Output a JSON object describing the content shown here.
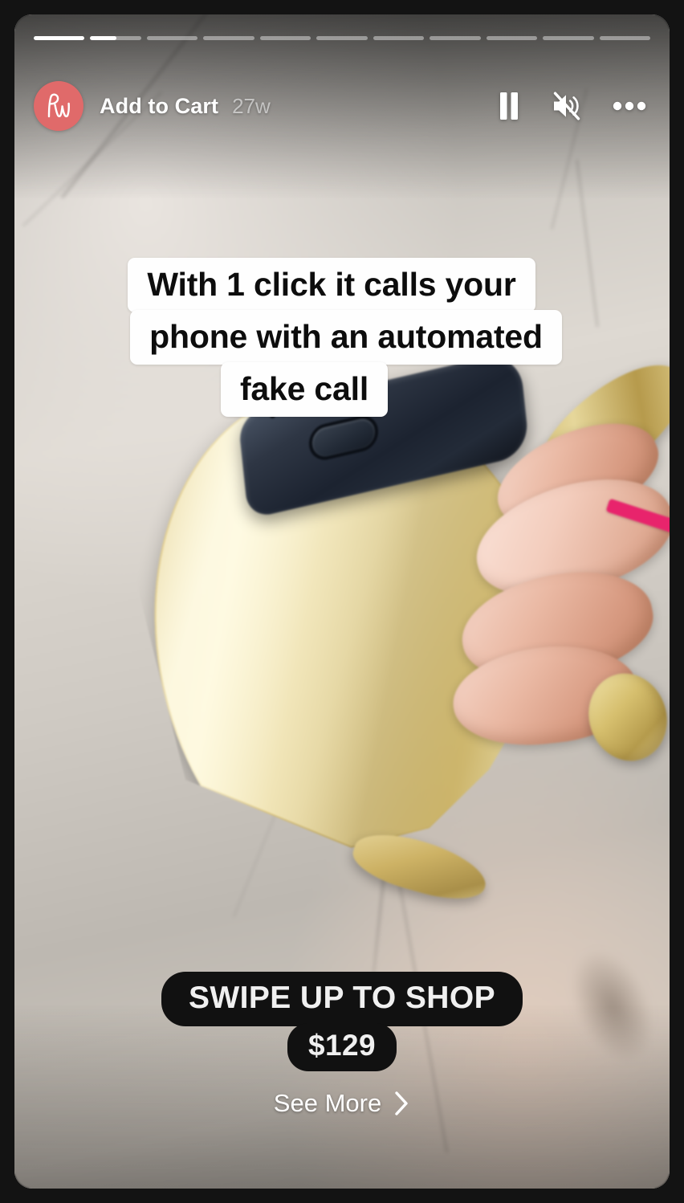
{
  "story": {
    "progress": {
      "total_segments": 11,
      "segment_fill_percent": [
        100,
        52,
        0,
        0,
        0,
        0,
        0,
        0,
        0,
        0,
        0
      ]
    },
    "header": {
      "avatar": {
        "initials": "PW",
        "background_color": "#e06a6a",
        "icon": "profile-avatar"
      },
      "username": "Add to Cart",
      "timestamp": "27w",
      "controls": [
        {
          "name": "pause-button",
          "icon": "pause-icon"
        },
        {
          "name": "mute-button",
          "icon": "speaker-muted-icon"
        },
        {
          "name": "more-options-button",
          "icon": "ellipsis-icon"
        }
      ]
    },
    "caption": {
      "lines": [
        "With 1 click it calls your",
        "phone with an automated",
        "fake call"
      ],
      "background_color": "#fefefe",
      "text_color": "#0d0d0d"
    },
    "cta": {
      "swipe_label": "SWIPE UP TO SHOP",
      "price": "$129",
      "see_more_label": "See More",
      "chevron_icon": "chevron-right-icon",
      "pill_color": "#111111"
    },
    "media": {
      "description": "gold cuff bracelet with dark smart module held in fingers over marble surface",
      "frame_color": "#131313"
    }
  }
}
